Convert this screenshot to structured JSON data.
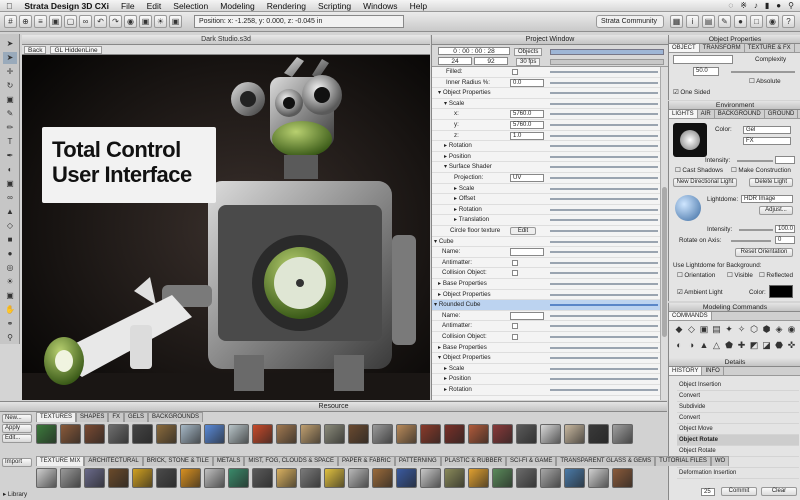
{
  "menubar": {
    "app": "Strata Design 3D CXi",
    "items": [
      "File",
      "Edit",
      "Selection",
      "Modeling",
      "Rendering",
      "Scripting",
      "Windows",
      "Help"
    ]
  },
  "toolbar": {
    "coords": "Position: x: -1.258, y: 0.000, z: -0.045 in",
    "community": "Strata Community"
  },
  "document": {
    "title": "Dark Studio.s3d",
    "back": "Back",
    "renderer": "GL HiddenLine"
  },
  "headline": {
    "line1": "Total Control",
    "line2": "User Interface"
  },
  "project": {
    "title": "Project Window",
    "timecode": "0 : 00 : 00 : 28",
    "frame_a": "24",
    "frame_b": "92",
    "objects": "Objects",
    "fps": "30 fps",
    "rows": [
      {
        "label": "Filled:",
        "indent": 14,
        "type": "chk"
      },
      {
        "label": "Inner Radius %:",
        "indent": 14,
        "type": "val",
        "value": "0.0"
      },
      {
        "label": "▾ Object Properties",
        "indent": 6,
        "type": "none"
      },
      {
        "label": "▾ Scale",
        "indent": 12,
        "type": "none"
      },
      {
        "label": "x:",
        "indent": 22,
        "type": "val",
        "value": "5760.0"
      },
      {
        "label": "y:",
        "indent": 22,
        "type": "val",
        "value": "5760.0"
      },
      {
        "label": "z:",
        "indent": 22,
        "type": "val",
        "value": "1.0"
      },
      {
        "label": "▸ Rotation",
        "indent": 12,
        "type": "none"
      },
      {
        "label": "▸ Position",
        "indent": 12,
        "type": "none"
      },
      {
        "label": "▾ Surface Shader",
        "indent": 12,
        "type": "none"
      },
      {
        "label": "Projection:",
        "indent": 22,
        "type": "val",
        "value": "UV"
      },
      {
        "label": "▸ Scale",
        "indent": 22,
        "type": "none"
      },
      {
        "label": "▸ Offset",
        "indent": 22,
        "type": "none"
      },
      {
        "label": "▸ Rotation",
        "indent": 22,
        "type": "none"
      },
      {
        "label": "▸ Translation",
        "indent": 22,
        "type": "none"
      },
      {
        "label": "Circle floor texture",
        "indent": 18,
        "type": "btn",
        "value": "Edit"
      },
      {
        "label": "▾ Cube",
        "indent": 2,
        "type": "none"
      },
      {
        "label": "Name:",
        "indent": 10,
        "type": "val",
        "value": ""
      },
      {
        "label": "Antimatter:",
        "indent": 10,
        "type": "chk"
      },
      {
        "label": "Collision Object:",
        "indent": 10,
        "type": "chk"
      },
      {
        "label": "▸ Base Properties",
        "indent": 6,
        "type": "none"
      },
      {
        "label": "▸ Object Properties",
        "indent": 6,
        "type": "none"
      },
      {
        "label": "▾ Rounded Cube",
        "indent": 2,
        "type": "none",
        "selected": true
      },
      {
        "label": "Name:",
        "indent": 10,
        "type": "val",
        "value": ""
      },
      {
        "label": "Antimatter:",
        "indent": 10,
        "type": "chk"
      },
      {
        "label": "Collision Object:",
        "indent": 10,
        "type": "chk"
      },
      {
        "label": "▸ Base Properties",
        "indent": 6,
        "type": "none"
      },
      {
        "label": "▾ Object Properties",
        "indent": 6,
        "type": "none"
      },
      {
        "label": "▸ Scale",
        "indent": 12,
        "type": "none"
      },
      {
        "label": "▸ Position",
        "indent": 12,
        "type": "none"
      },
      {
        "label": "▸ Rotation",
        "indent": 12,
        "type": "none"
      }
    ]
  },
  "object_properties": {
    "title": "Object Properties",
    "tabs": [
      "Object",
      "Transform",
      "Texture & FX"
    ],
    "complexity_label": "Complexity",
    "complexity": "50.0",
    "absolute": "Absolute",
    "one_sided": "One Sided"
  },
  "environment": {
    "title": "Environment",
    "tabs": [
      "Lights",
      "Air",
      "Background",
      "Ground"
    ],
    "color_label": "Color:",
    "gel": "Gel",
    "fx": "FX",
    "intensity_label": "Intensity:",
    "cast_shadows": "Cast Shadows",
    "make_construction": "Make Construction",
    "new_light": "New Directional Light",
    "delete_light": "Delete Light",
    "lightdome_label": "Lightdome:",
    "lightdome": "HDR Image",
    "adjust": "Adjust...",
    "intensity2": "100.0",
    "rotate_label": "Rotate on Axis:",
    "rotate": "0",
    "reset": "Reset Orientation",
    "use_lightdome": "Use Lightdome for Background:",
    "orientation": "Orientation",
    "visible": "Visible",
    "reflected": "Reflected",
    "ambient": "Ambient Light",
    "ambient_color": "Color:"
  },
  "modeling": {
    "title": "Modeling Commands",
    "tab": "Commands"
  },
  "details": {
    "title": "Details",
    "tabs": [
      "History",
      "Info"
    ],
    "history": [
      "Object Insertion",
      "Convert",
      "Subdivide",
      "Convert",
      "Object Move",
      "Object Rotate",
      "Object Rotate",
      "Object Scale",
      "Deformation Insertion"
    ],
    "selected_index": 5,
    "steps": "25",
    "commit": "Commit",
    "clear": "Clear"
  },
  "resource": {
    "title": "Resource",
    "buttons": [
      "New...",
      "Apply",
      "Edit...",
      "Import"
    ],
    "library": "▸ Library",
    "tabs1": [
      "Textures",
      "Shapes",
      "FX",
      "Gels",
      "Backgrounds"
    ],
    "tabs2": [
      "Texture Mix",
      "Architectural",
      "Brick, Stone & Tile",
      "Metals",
      "Mist, Fog, Clouds & Space",
      "Paper & Fabric",
      "Patterning",
      "Plastic & Rubber",
      "Sci-Fi & Game",
      "Transparent Glass & Gems",
      "Tutorial Files",
      "Wo"
    ],
    "swatches1": [
      "#3c7a3c",
      "#8a5a3a",
      "#7a4a32",
      "#6e6e6e",
      "#444444",
      "#8a6a3c",
      "#a6b8c6",
      "#5a8ad8",
      "#b8c4c8",
      "#c84a2a",
      "#a07850",
      "#c0a070",
      "#8a8a7a",
      "#6a4a30",
      "#9a9a9a",
      "#b88a5a",
      "#8a3a2a",
      "#7a3028",
      "#b05a3a",
      "#8a3a3a",
      "#5a5a5a",
      "#d8d8d8",
      "#c8b8a0",
      "#3a3a3a",
      "#a0a0a0"
    ],
    "swatches2": [
      "#cfcfcf",
      "#9a9a9a",
      "#6a6a8a",
      "#6a4a2a",
      "#d0a020",
      "#4a4a4a",
      "#d89020",
      "#c0c0c0",
      "#3a8a6a",
      "#5a5a5a",
      "#d8b060",
      "#7a7a7a",
      "#e0c040",
      "#b8b8b8",
      "#9a6a3a",
      "#3a5aa0",
      "#c8c8c8",
      "#8a8a5a",
      "#e0a030",
      "#5a8a5a",
      "#6a6a6a",
      "#a8a8a8",
      "#4a7aa8",
      "#d0d0d0",
      "#8a5a3a"
    ]
  }
}
